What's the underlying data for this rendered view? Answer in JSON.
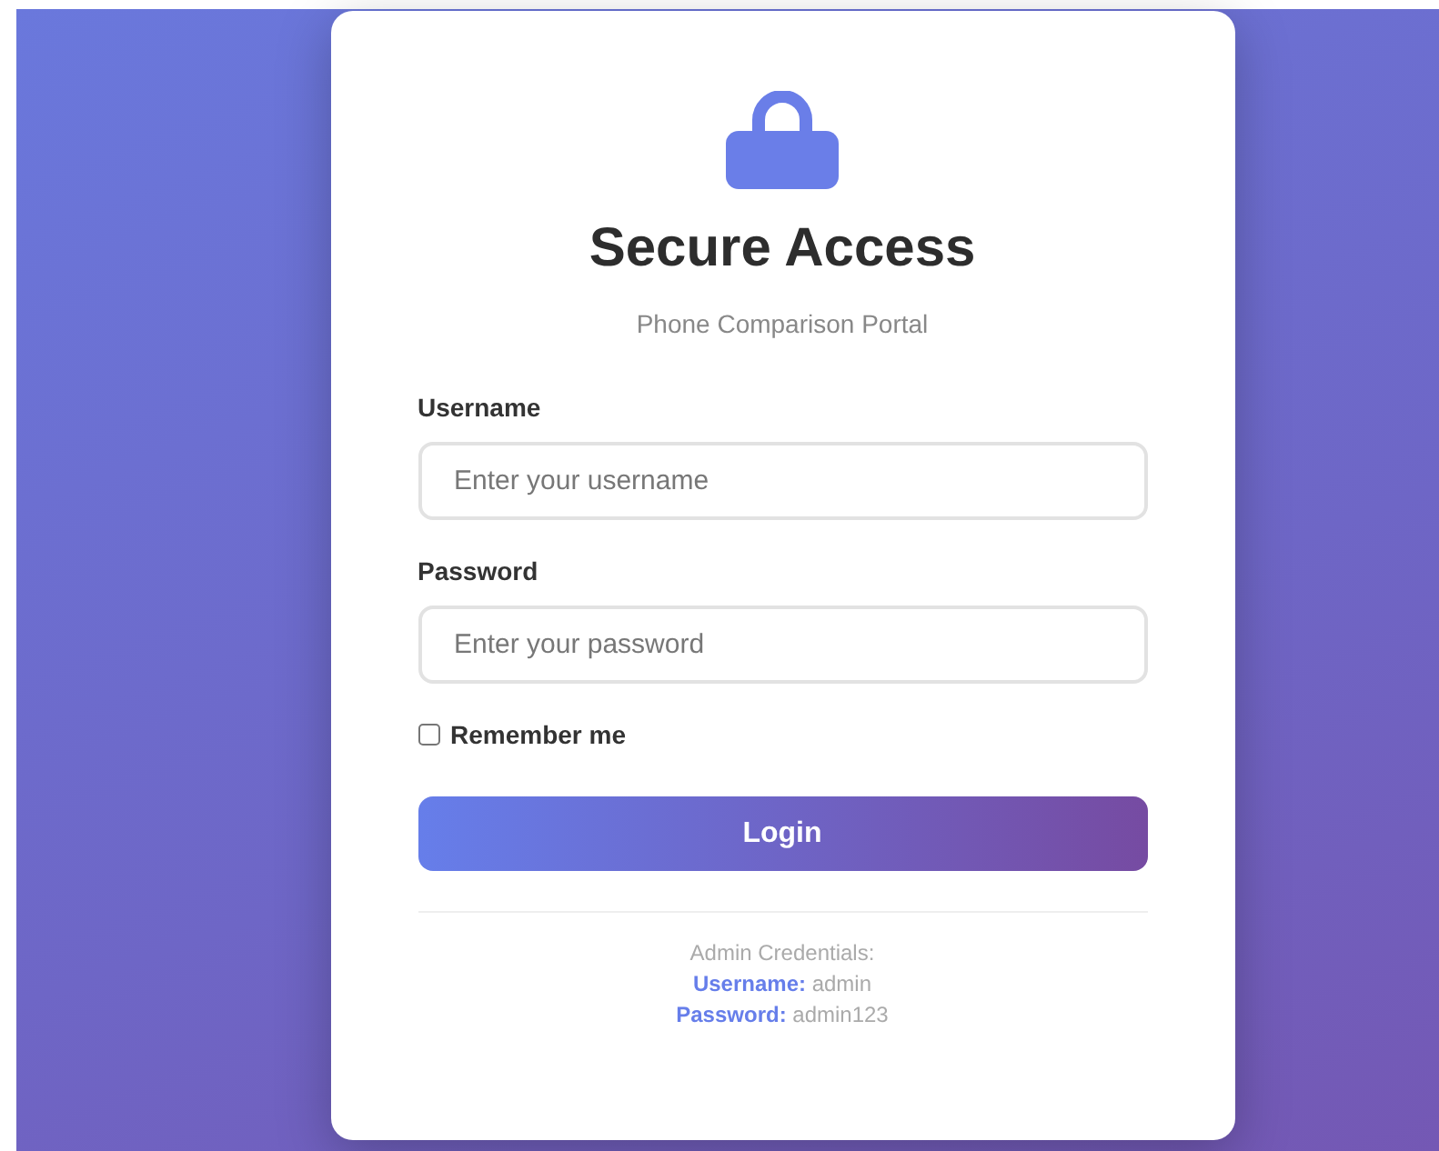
{
  "title": "Secure Access",
  "subtitle": "Phone Comparison Portal",
  "fields": [
    {
      "label": "Username",
      "placeholder": "Enter your username"
    },
    {
      "label": "Password",
      "placeholder": "Enter your password"
    }
  ],
  "remember": {
    "label": "Remember me",
    "checked": false
  },
  "button": "Login",
  "credentials": {
    "heading": "Admin Credentials:",
    "items": [
      {
        "label": "Username:",
        "value": "admin"
      },
      {
        "label": "Password:",
        "value": "admin123"
      }
    ]
  }
}
